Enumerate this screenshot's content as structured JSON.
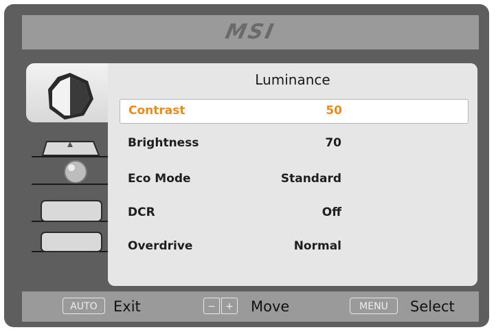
{
  "brand": {
    "logo_text": "MSI"
  },
  "panel": {
    "title": "Luminance"
  },
  "menu": [
    {
      "label": "Contrast",
      "value": "50",
      "selected": true
    },
    {
      "label": "Brightness",
      "value": "70"
    },
    {
      "label": "Eco Mode",
      "value": "Standard"
    },
    {
      "label": "DCR",
      "value": "Off"
    },
    {
      "label": "Overdrive",
      "value": "Normal"
    }
  ],
  "side_tabs": [
    {
      "icon": "luminance-icon",
      "active": true
    },
    {
      "icon": "image-icon"
    },
    {
      "icon": "color-icon"
    },
    {
      "icon": "osd-settings-icon"
    },
    {
      "icon": "extra-icon"
    }
  ],
  "keys": {
    "auto_badge": "AUTO",
    "auto_label": "Exit",
    "minus_badge": "−",
    "plus_badge": "+",
    "move_label": "Move",
    "menu_badge": "MENU",
    "menu_label": "Select"
  },
  "colors": {
    "selected_text": "#e98a1f",
    "frame": "#5e5e5e",
    "bar": "#9a9a9a",
    "panel": "#e6e6e6"
  }
}
